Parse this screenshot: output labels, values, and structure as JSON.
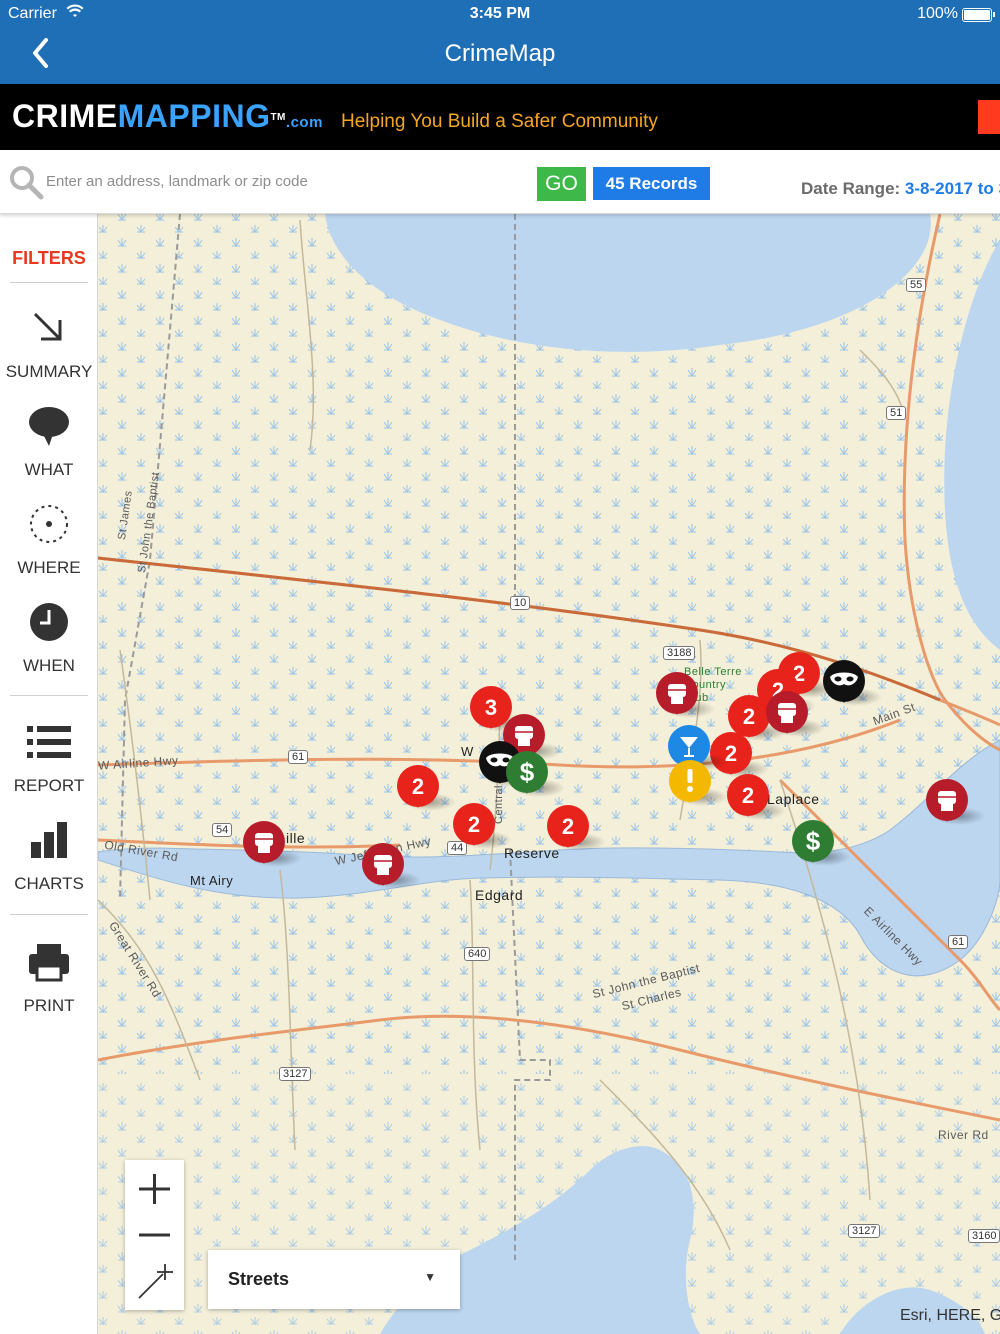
{
  "status": {
    "carrier": "Carrier",
    "time": "3:45 PM",
    "battery": "100%"
  },
  "nav": {
    "title": "CrimeMap"
  },
  "banner": {
    "logo_white": "CRIME",
    "logo_blue": "MAPPING",
    "logo_tm": "TM",
    "logo_com": ".com",
    "tagline": "Helping You Build a Safer Community"
  },
  "search": {
    "placeholder": "Enter an address, landmark or zip code",
    "value": "",
    "go_label": "GO",
    "records_label": "45 Records",
    "date_label": "Date Range: ",
    "date_value": "3-8-2017 to 3"
  },
  "sidebar": {
    "filters": "FILTERS",
    "items": [
      {
        "label": "SUMMARY",
        "icon": "arrow-down-right-icon"
      },
      {
        "label": "WHAT",
        "icon": "speech-bubble-icon"
      },
      {
        "label": "WHERE",
        "icon": "location-target-icon"
      },
      {
        "label": "WHEN",
        "icon": "clock-icon"
      },
      {
        "label": "REPORT",
        "icon": "list-icon"
      },
      {
        "label": "CHARTS",
        "icon": "bar-chart-icon"
      },
      {
        "label": "PRINT",
        "icon": "printer-icon"
      }
    ]
  },
  "map": {
    "places": [
      "Laplace",
      "Reserve",
      "Edgard",
      "Mt Airy",
      "ille",
      "W Airline Hwy",
      "Old River Rd",
      "Great River Rd",
      "W Jefferson Hwy",
      "Main St",
      "E Airline Hwy",
      "River Rd",
      "St John the Baptist",
      "St Charles",
      "St James",
      "St John the Baptist",
      "Central Ave",
      "Belle Terre Country Club",
      "W"
    ],
    "shields": [
      "55",
      "51",
      "10",
      "3188",
      "61",
      "54",
      "44",
      "640",
      "61",
      "3127",
      "3127",
      "3160"
    ],
    "markers": [
      {
        "type": "cluster",
        "count": "3",
        "color": "#e8231c"
      },
      {
        "type": "cluster",
        "count": "2",
        "color": "#e8231c"
      },
      {
        "type": "cluster",
        "count": "2",
        "color": "#e8231c"
      },
      {
        "type": "cluster",
        "count": "2",
        "color": "#e8231c"
      },
      {
        "type": "cluster",
        "count": "2",
        "color": "#e8231c"
      },
      {
        "type": "cluster",
        "count": "2",
        "color": "#e8231c"
      },
      {
        "type": "cluster",
        "count": "2",
        "color": "#e8231c"
      },
      {
        "type": "cluster",
        "count": "2",
        "color": "#e8231c"
      },
      {
        "type": "cluster",
        "count": "2",
        "color": "#e8231c"
      },
      {
        "type": "assault",
        "icon": "fist-icon",
        "color": "#b71c2a"
      },
      {
        "type": "assault",
        "icon": "fist-icon",
        "color": "#b71c2a"
      },
      {
        "type": "assault",
        "icon": "fist-icon",
        "color": "#b71c2a"
      },
      {
        "type": "assault",
        "icon": "fist-icon",
        "color": "#b71c2a"
      },
      {
        "type": "assault",
        "icon": "fist-icon",
        "color": "#b71c2a"
      },
      {
        "type": "assault",
        "icon": "fist-icon",
        "color": "#b71c2a"
      },
      {
        "type": "robbery",
        "icon": "mask-icon",
        "color": "#111111"
      },
      {
        "type": "robbery",
        "icon": "mask-icon",
        "color": "#111111"
      },
      {
        "type": "theft",
        "icon": "dollar-icon",
        "color": "#2e7d32"
      },
      {
        "type": "theft",
        "icon": "dollar-icon",
        "color": "#2e7d32"
      },
      {
        "type": "dui",
        "icon": "cocktail-icon",
        "color": "#1e88e5"
      },
      {
        "type": "other",
        "icon": "exclamation-icon",
        "color": "#f5b800"
      }
    ],
    "zoom_in": "+",
    "zoom_out": "−",
    "basemap": "Streets",
    "basemap_arrow": "▼",
    "attribution": "Esri, HERE, G"
  }
}
